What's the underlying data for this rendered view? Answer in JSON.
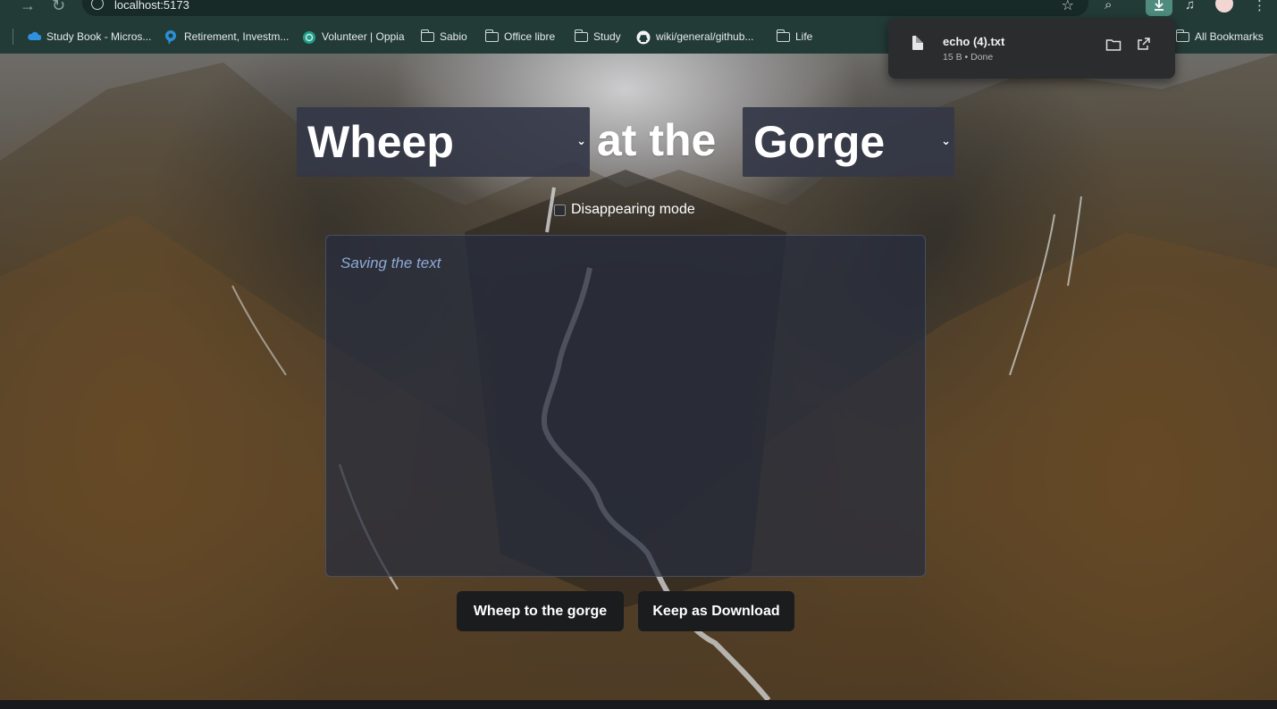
{
  "browser": {
    "url": "localhost:5173",
    "bookmarks": [
      {
        "label": "Study Book - Micros...",
        "icon": "onedrive-icon"
      },
      {
        "label": "Retirement, Investm...",
        "icon": "pin-icon"
      },
      {
        "label": "Volunteer | Oppia",
        "icon": "oppia-icon"
      },
      {
        "label": "Sabio",
        "icon": "folder-icon"
      },
      {
        "label": "Office libre",
        "icon": "folder-icon"
      },
      {
        "label": "Study",
        "icon": "folder-icon"
      },
      {
        "label": "wiki/general/github...",
        "icon": "github-icon"
      },
      {
        "label": "Life",
        "icon": "folder-icon"
      }
    ],
    "all_bookmarks": "All Bookmarks",
    "download": {
      "filename": "echo (4).txt",
      "status": "15 B • Done"
    }
  },
  "app": {
    "verb_select": "Wheep",
    "connector": "at the",
    "place_select": "Gorge",
    "disappearing_label": "Disappearing mode",
    "disappearing_checked": false,
    "editor_placeholder": "Saving the text",
    "primary_button": "Wheep to the gorge",
    "secondary_button": "Keep as Download"
  },
  "colors": {
    "chrome": "#233b36",
    "select_bg": "#343746",
    "button_bg": "#1b1c1e",
    "placeholder": "#8ea9d6",
    "download_active": "#4f8c7f"
  }
}
